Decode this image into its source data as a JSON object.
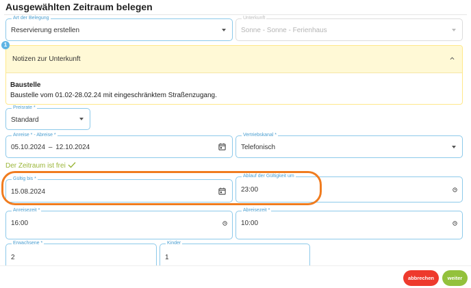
{
  "dialog": {
    "title": "Ausgewählten Zeitraum belegen"
  },
  "form": {
    "art": {
      "label": "Art der Belegung",
      "value": "Reservierung erstellen"
    },
    "unterkunft": {
      "label": "Unterkunft",
      "value": "Sonne - Sonne - Ferienhaus"
    },
    "notes": {
      "badge": "1",
      "header": "Notizen zur Unterkunft",
      "title": "Baustelle",
      "text": "Baustelle vom 01.02-28.02.24 mit eingeschränktem Straßenzugang."
    },
    "preisrate": {
      "label": "Preisrate *",
      "value": "Standard"
    },
    "dates": {
      "label": "Anreise * - Abreise *",
      "start": "05.10.2024",
      "separator": "–",
      "end": "12.10.2024"
    },
    "vertriebskanal": {
      "label": "Vertriebskanal *",
      "value": "Telefonisch"
    },
    "availability": {
      "text": "Der Zeitraum ist frei"
    },
    "gueltig_bis": {
      "label": "Gültig bis *",
      "value": "15.08.2024"
    },
    "ablauf": {
      "label": "Ablauf der Gültigkeit um",
      "value": "23:00"
    },
    "anreisezeit": {
      "label": "Anreisezeit *",
      "value": "16:00"
    },
    "abreisezeit": {
      "label": "Abreisezeit *",
      "value": "10:00"
    },
    "erwachsene": {
      "label": "Erwachsene *",
      "value": "2"
    },
    "kinder": {
      "label": "Kinder",
      "value": "1"
    }
  },
  "actions": {
    "cancel": "abbrechen",
    "next": "weiter"
  },
  "colors": {
    "field_border": "#8cc9ea",
    "note_background": "#fff9d6",
    "success": "#9ab537",
    "highlight": "#f07c1f",
    "cancel_button": "#ee3a2d",
    "next_button": "#93c13c"
  }
}
